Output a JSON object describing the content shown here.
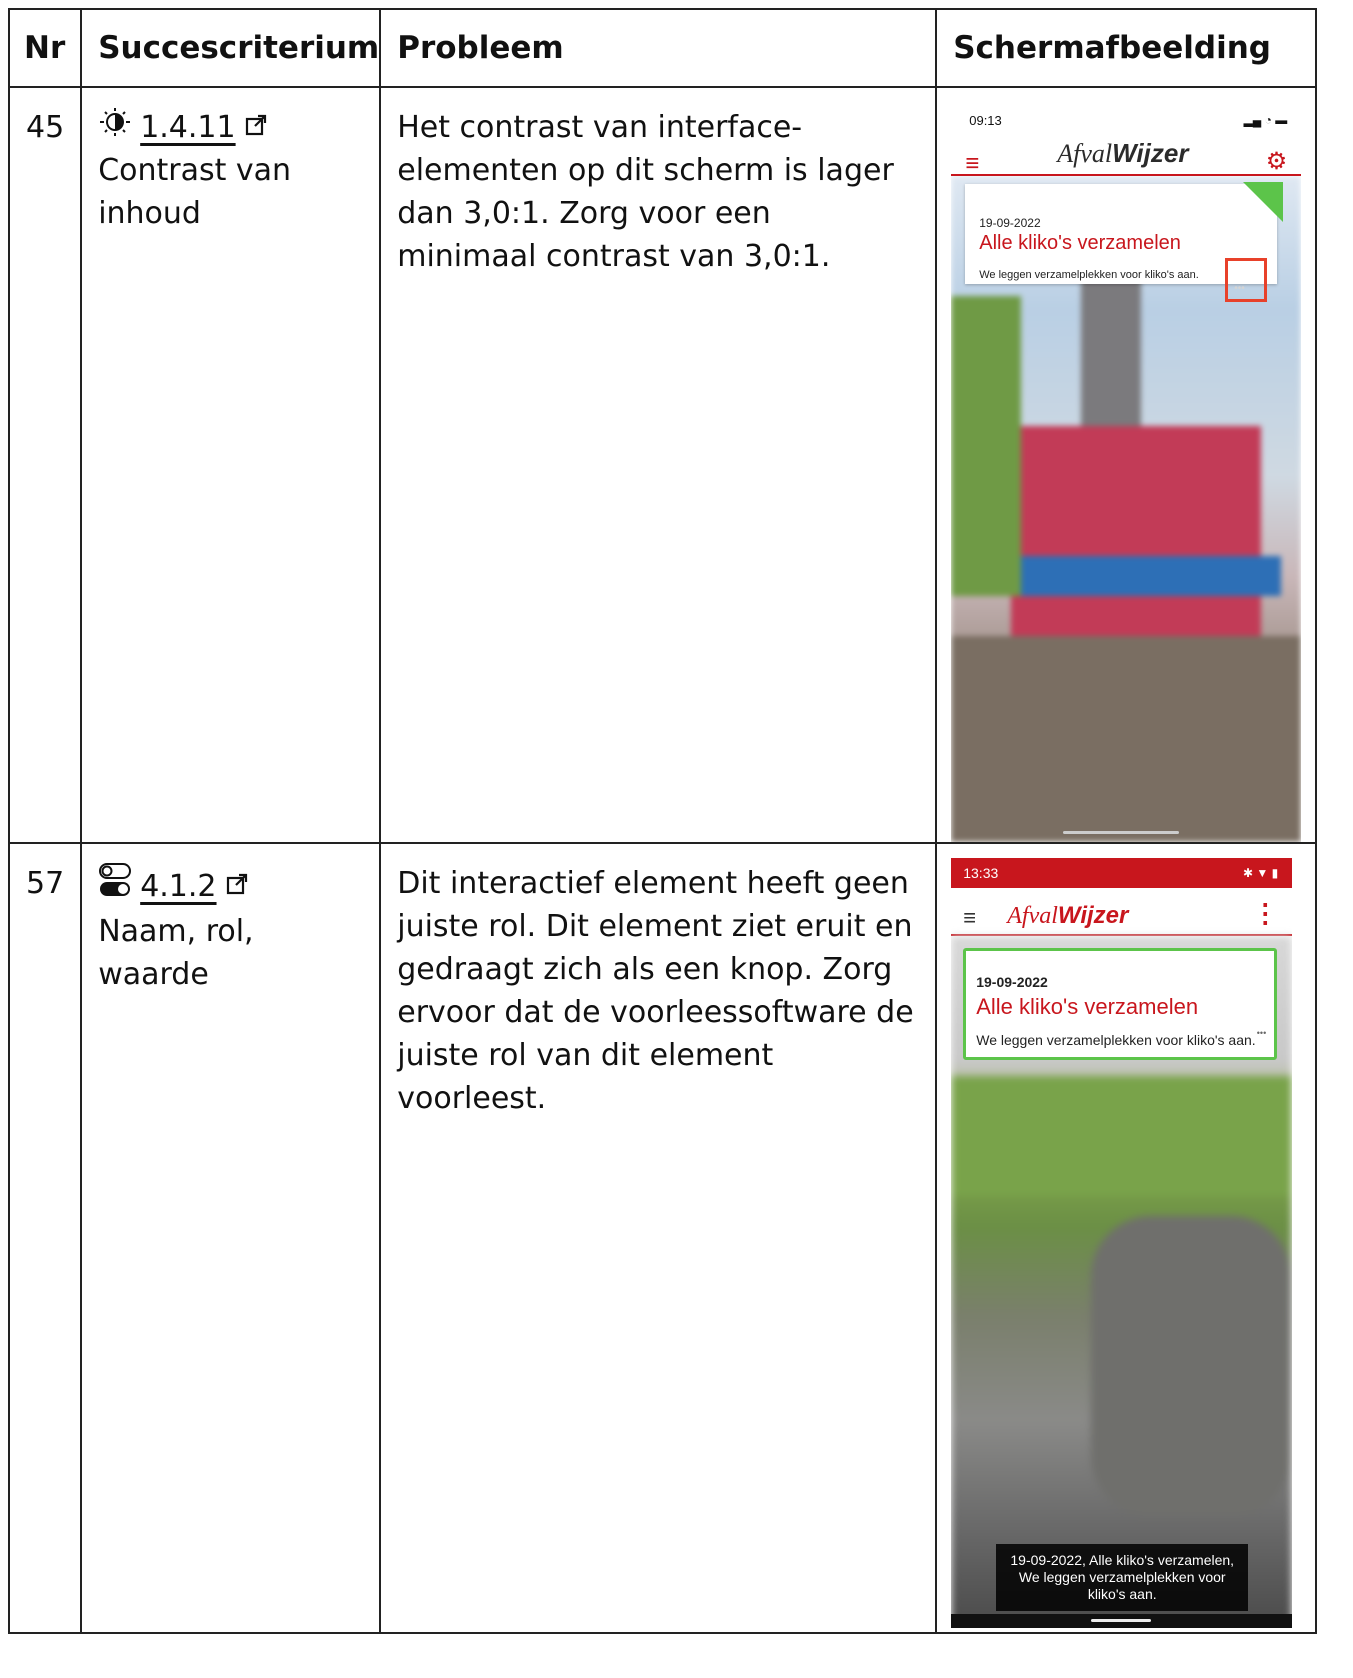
{
  "table": {
    "headers": {
      "nr": "Nr",
      "criterion": "Succescriterium",
      "problem": "Probleem",
      "screenshot": "Schermafbeelding"
    },
    "rows": [
      {
        "nr": "45",
        "criterion_number": "1.4.11",
        "criterion_name": "Contrast van inhoud",
        "criterion_icon": "contrast-icon",
        "problem": "Het contrast van interface-elementen op dit scherm is lager dan 3,0:1. Zorg voor een minimaal contrast van 3,0:1.",
        "screenshot": {
          "status_time": "09:13",
          "brand_light": "Afval",
          "brand_bold": "Wijzer",
          "card_date": "19-09-2022",
          "card_title": "Alle kliko's verzamelen",
          "card_subtitle": "We leggen verzamelplekken voor kliko's aan.",
          "more_label": "•••"
        }
      },
      {
        "nr": "57",
        "criterion_number": "4.1.2",
        "criterion_name": "Naam, rol, waarde",
        "criterion_icon": "toggle-icon",
        "problem": "Dit interactief element heeft geen juiste rol. Dit element ziet eruit en gedraagt zich als een knop. Zorg ervoor dat de voorleessoftware de juiste rol van dit element voorleest.",
        "screenshot": {
          "status_time": "13:33",
          "brand_light": "Afval",
          "brand_bold": "Wijzer",
          "card_date": "19-09-2022",
          "card_title": "Alle kliko's verzamelen",
          "card_subtitle": "We leggen verzamelplekken voor kliko's aan.",
          "more_label": "•••",
          "tooltip": "19-09-2022, Alle kliko's verzamelen, We leggen verzamelplekken voor kliko's aan."
        }
      }
    ]
  },
  "colors": {
    "brand_red": "#c8161d",
    "focus_green": "#5cc44a",
    "highlight_box": "#e8412a"
  }
}
